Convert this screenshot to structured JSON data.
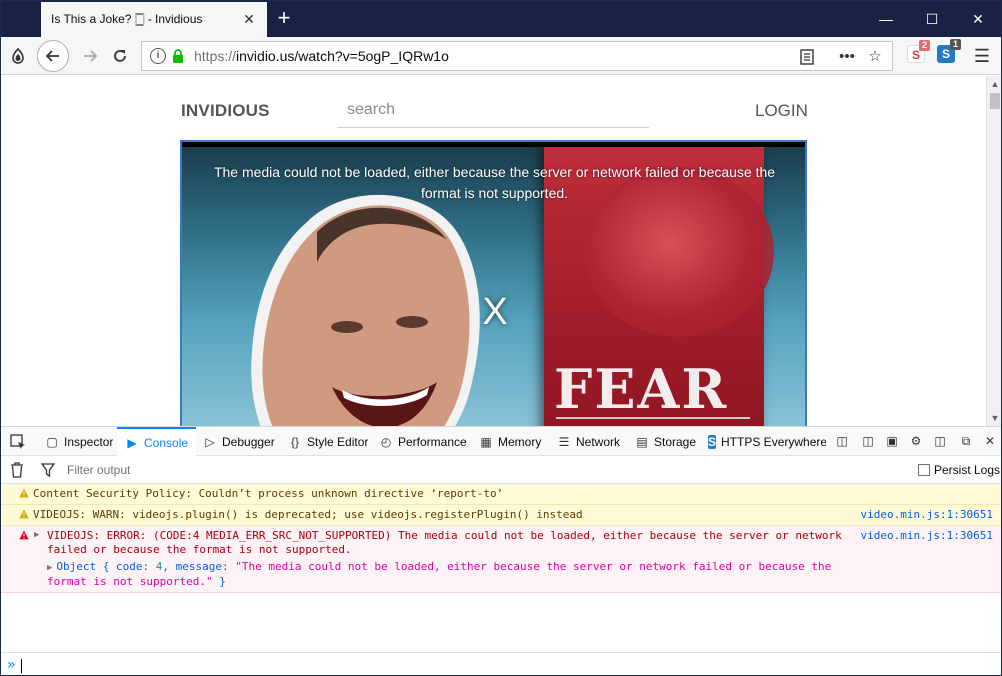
{
  "browser": {
    "tab_title": "Is This a Joke? 🀆 - Invidious",
    "url_scheme": "https://",
    "url_rest": "invidio.us/watch?v=5ogP_IQRw1o",
    "ext_privacy_badge": "2",
    "ext_https_badge": "1",
    "colors": {
      "titlebar": "#1b2145",
      "accent": "#0a84ff"
    }
  },
  "page": {
    "logo": "INVIDIOUS",
    "search_placeholder": "search",
    "login": "LOGIN",
    "player": {
      "error_message": "The media could not be loaded, either because the server or network failed or because the format is not supported.",
      "error_close": "X",
      "thumbnail_book_title": "FEAR"
    }
  },
  "devtools": {
    "tabs": [
      {
        "label": "Inspector",
        "icon": "inspector-icon"
      },
      {
        "label": "Console",
        "icon": "console-icon",
        "active": true
      },
      {
        "label": "Debugger",
        "icon": "debugger-icon"
      },
      {
        "label": "Style Editor",
        "icon": "style-editor-icon"
      },
      {
        "label": "Performance",
        "icon": "performance-icon"
      },
      {
        "label": "Memory",
        "icon": "memory-icon"
      },
      {
        "label": "Network",
        "icon": "network-icon"
      },
      {
        "label": "Storage",
        "icon": "storage-icon"
      },
      {
        "label": "HTTPS Everywhere",
        "icon": "https-everywhere-icon"
      }
    ],
    "filter_placeholder": "Filter output",
    "persist_logs": "Persist Logs",
    "messages": [
      {
        "level": "warn",
        "text": "Content Security Policy: Couldn’t process unknown directive ‘report-to’",
        "source": ""
      },
      {
        "level": "warn",
        "text": "VIDEOJS: WARN: videojs.plugin() is deprecated; use videojs.registerPlugin() instead",
        "source": "video.min.js:1:30651"
      },
      {
        "level": "error",
        "text": "VIDEOJS: ERROR: (CODE:4 MEDIA_ERR_SRC_NOT_SUPPORTED) The media could not be loaded, either because the server or network failed or because the format is not supported.",
        "source": "video.min.js:1:30651"
      }
    ],
    "error_object": {
      "prefix": "Object { ",
      "code_key": "code:",
      "code_val": " 4",
      "sep": ", ",
      "message_key": "message:",
      "message_val": " \"The media could not be loaded, either because the server or network failed or because the format is not supported.\"",
      "suffix": " }"
    },
    "prompt": "»"
  }
}
